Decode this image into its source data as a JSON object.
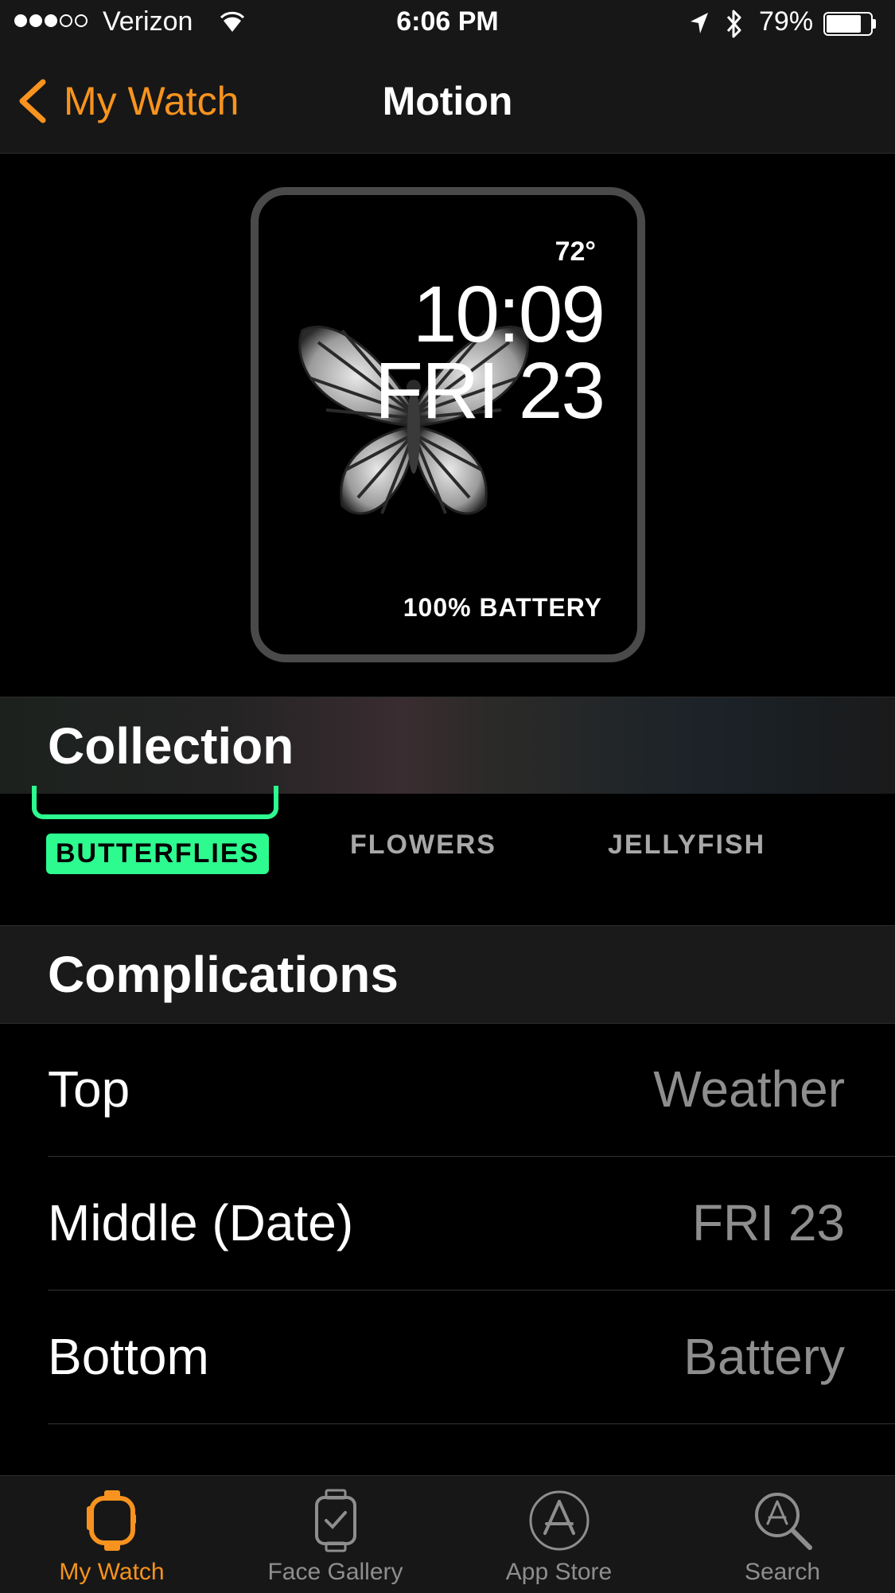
{
  "status_bar": {
    "carrier": "Verizon",
    "signal_bars_filled": 3,
    "signal_bars_total": 5,
    "time": "6:06 PM",
    "battery_percent": "79%",
    "battery_level": 0.79
  },
  "nav": {
    "back_label": "My Watch",
    "title": "Motion"
  },
  "watch_preview": {
    "temperature": "72°",
    "time": "10:09",
    "date": "FRI 23",
    "battery": "100% BATTERY"
  },
  "collection": {
    "header": "Collection",
    "options": [
      {
        "label": "BUTTERFLIES",
        "selected": true
      },
      {
        "label": "FLOWERS",
        "selected": false
      },
      {
        "label": "JELLYFISH",
        "selected": false
      }
    ],
    "accent_color": "#2dfa8f"
  },
  "complications": {
    "header": "Complications",
    "rows": [
      {
        "label": "Top",
        "value": "Weather"
      },
      {
        "label": "Middle (Date)",
        "value": "FRI 23"
      },
      {
        "label": "Bottom",
        "value": "Battery"
      }
    ]
  },
  "tab_bar": {
    "tabs": [
      {
        "label": "My Watch",
        "icon": "watch-icon",
        "active": true
      },
      {
        "label": "Face Gallery",
        "icon": "face-gallery-icon",
        "active": false
      },
      {
        "label": "App Store",
        "icon": "app-store-icon",
        "active": false
      },
      {
        "label": "Search",
        "icon": "search-icon",
        "active": false
      }
    ],
    "active_color": "#f7931e",
    "inactive_color": "#8e8e8e"
  }
}
